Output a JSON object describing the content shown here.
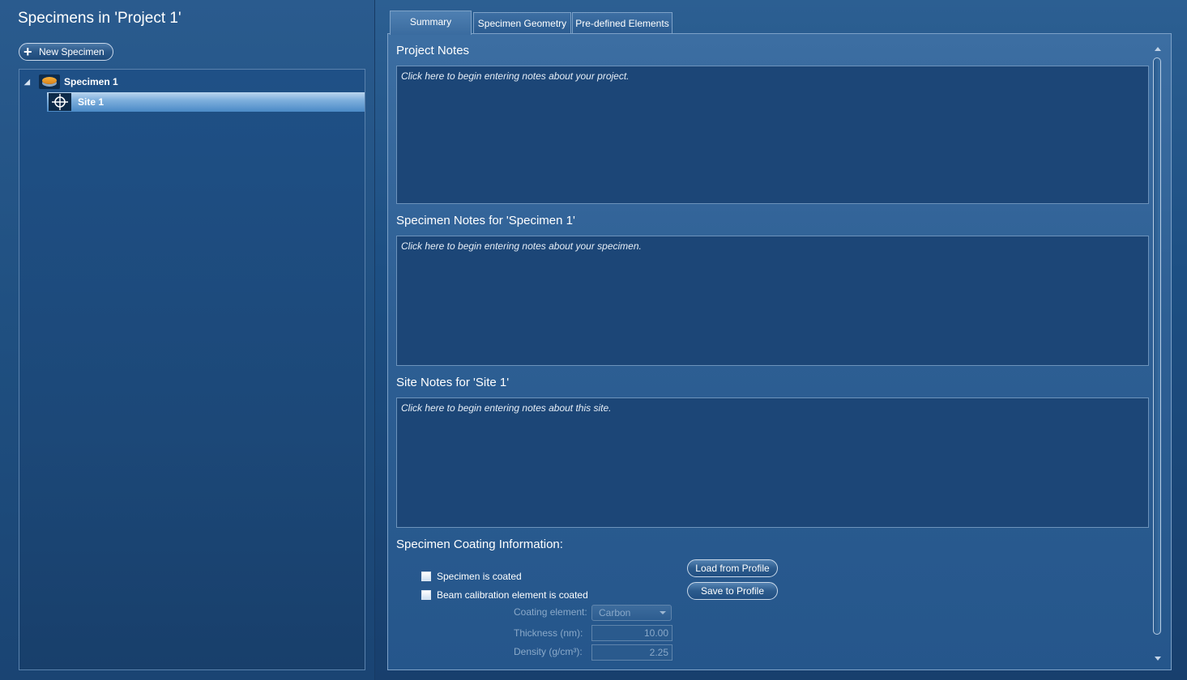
{
  "left_panel": {
    "title": "Specimens in 'Project 1'",
    "new_specimen_label": "New Specimen",
    "tree": {
      "specimen": {
        "label": "Specimen 1",
        "expanded": true
      },
      "site": {
        "label": "Site 1",
        "selected": true
      }
    }
  },
  "tabs": [
    {
      "label": "Summary",
      "active": true
    },
    {
      "label": "Specimen Geometry",
      "active": false
    },
    {
      "label": "Pre-defined Elements",
      "active": false
    }
  ],
  "summary": {
    "project_notes": {
      "heading": "Project Notes",
      "placeholder": "Click here to begin entering notes about your project."
    },
    "specimen_notes": {
      "heading": "Specimen Notes for 'Specimen 1'",
      "placeholder": "Click here to begin entering notes about your specimen."
    },
    "site_notes": {
      "heading": "Site Notes for 'Site 1'",
      "placeholder": "Click here to begin entering notes about this site."
    },
    "coating": {
      "heading": "Specimen Coating Information:",
      "specimen_coated_label": "Specimen is coated",
      "specimen_coated_checked": false,
      "beam_coated_label": "Beam calibration element is coated",
      "beam_coated_checked": false,
      "element_label": "Coating element:",
      "element_value": "Carbon",
      "thickness_label": "Thickness (nm):",
      "thickness_value": "10.00",
      "density_label": "Density (g/cm³):",
      "density_value": "2.25",
      "load_profile_label": "Load from Profile",
      "save_profile_label": "Save to Profile"
    }
  },
  "icons": {
    "new_specimen": "plus-icon",
    "specimen": "specimen-disk-icon",
    "site": "crosshair-icon",
    "expander": "expanded-triangle-icon"
  },
  "colors": {
    "background": "#1d4f83",
    "selection": "#7fb0dd",
    "specimen_icon": "#f7b13a"
  }
}
